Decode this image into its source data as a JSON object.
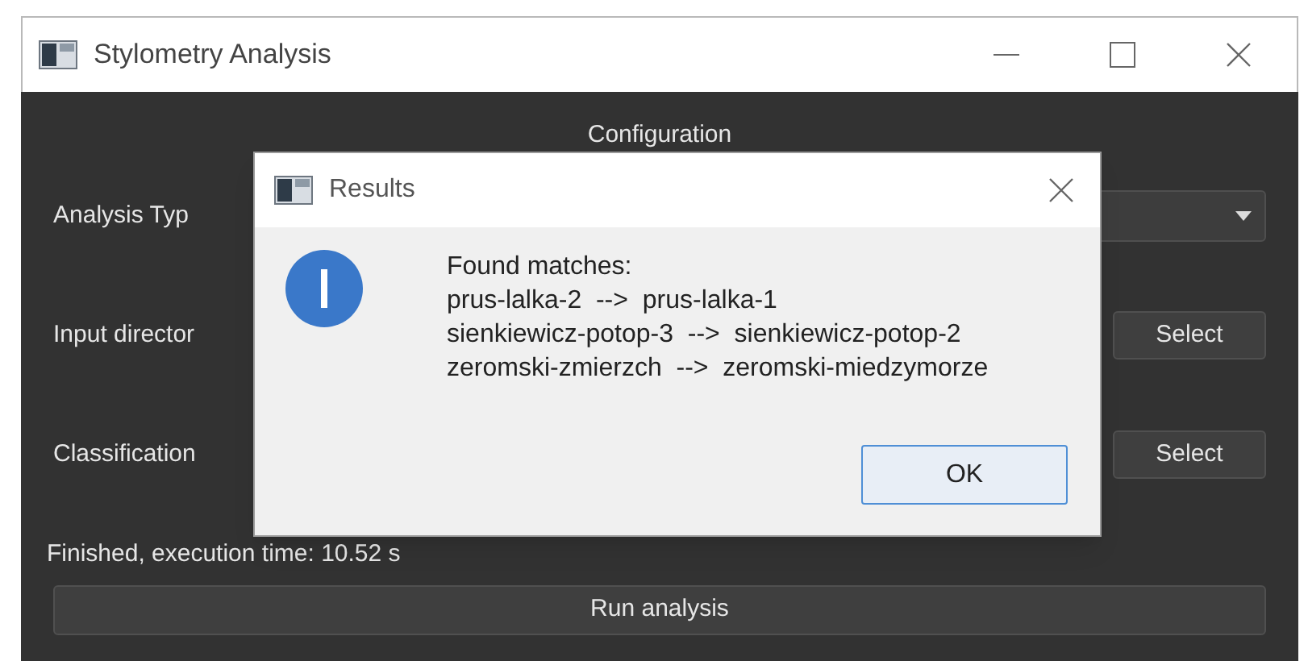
{
  "window": {
    "title": "Stylometry Analysis"
  },
  "section_title": "Configuration",
  "rows": [
    {
      "kind": "dropdown",
      "label": "Analysis Typ"
    },
    {
      "kind": "picker",
      "label": "Input director",
      "button": "Select"
    },
    {
      "kind": "picker",
      "label": "Classification",
      "button": "Select"
    }
  ],
  "status": "Finished, execution time: 10.52 s",
  "run_button": "Run analysis",
  "dialog": {
    "title": "Results",
    "lines": [
      "Found matches:",
      "prus-lalka-2  -->  prus-lalka-1",
      "sienkiewicz-potop-3  -->  sienkiewicz-potop-2",
      "zeromski-zmierzch  -->  zeromski-miedzymorze"
    ],
    "button": "OK"
  }
}
